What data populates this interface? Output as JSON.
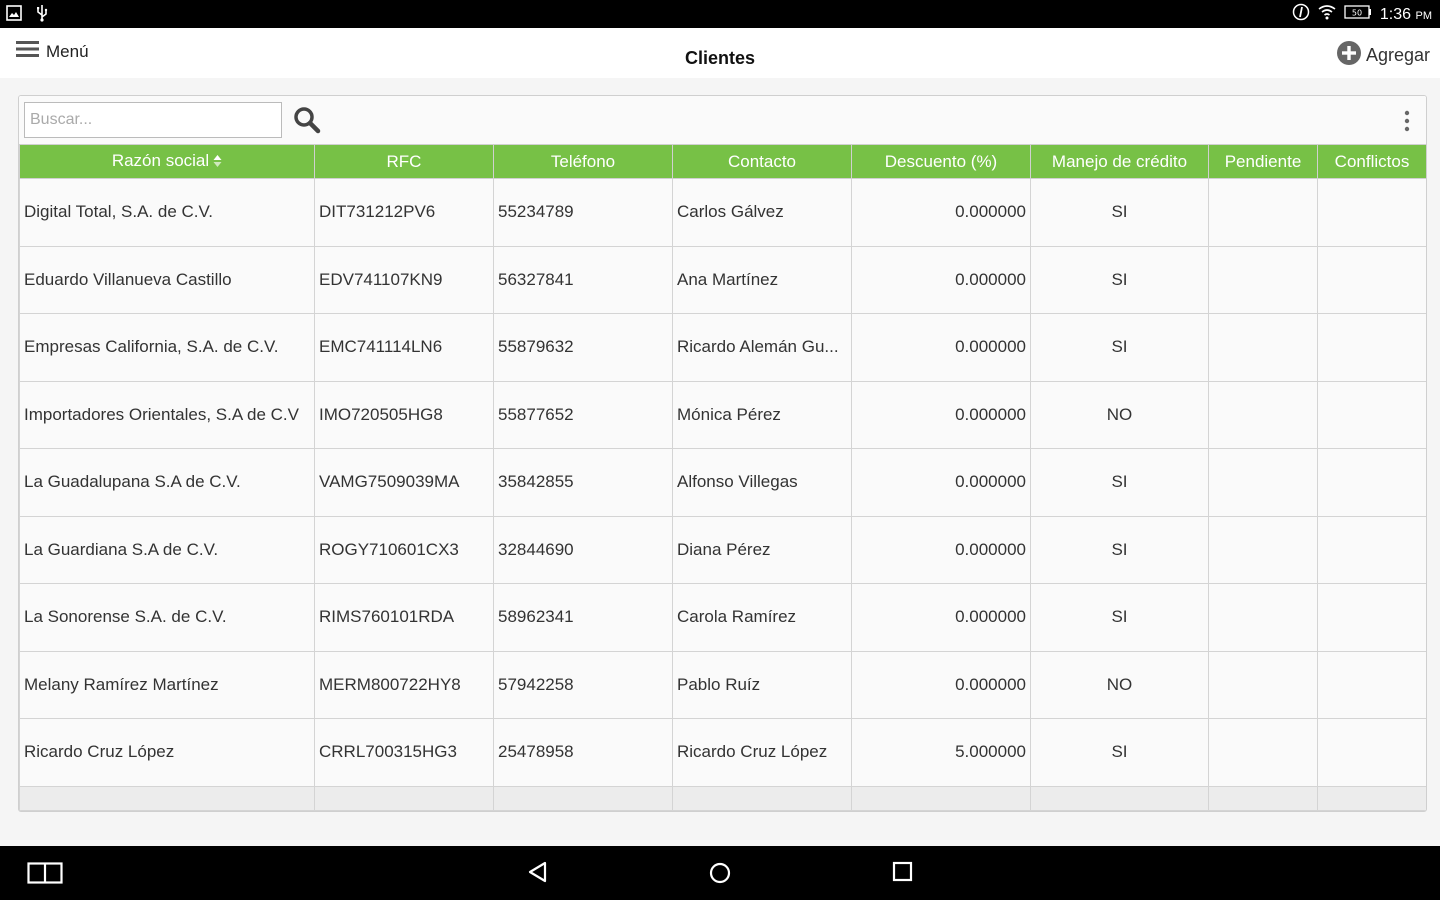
{
  "status": {
    "time": "1:36",
    "ampm": "PM",
    "battery": "50"
  },
  "header": {
    "menu_label": "Menú",
    "title": "Clientes",
    "add_label": "Agregar"
  },
  "search": {
    "placeholder": "Buscar...",
    "value": ""
  },
  "table": {
    "columns": [
      "Razón social",
      "RFC",
      "Teléfono",
      "Contacto",
      "Descuento (%)",
      "Manejo de crédito",
      "Pendiente",
      "Conflictos"
    ],
    "rows": [
      {
        "razon": "Digital Total, S.A. de C.V.",
        "rfc": "DIT731212PV6",
        "telefono": "55234789",
        "contacto": "Carlos Gálvez",
        "descuento": "0.000000",
        "credito": "SI",
        "pendiente": "",
        "conflictos": ""
      },
      {
        "razon": "Eduardo Villanueva Castillo",
        "rfc": "EDV741107KN9",
        "telefono": "56327841",
        "contacto": "Ana Martínez",
        "descuento": "0.000000",
        "credito": "SI",
        "pendiente": "",
        "conflictos": ""
      },
      {
        "razon": "Empresas California, S.A. de C.V.",
        "rfc": "EMC741114LN6",
        "telefono": "55879632",
        "contacto": "Ricardo Alemán Gu...",
        "descuento": "0.000000",
        "credito": "SI",
        "pendiente": "",
        "conflictos": ""
      },
      {
        "razon": "Importadores Orientales, S.A de C.V",
        "rfc": "IMO720505HG8",
        "telefono": "55877652",
        "contacto": "Mónica Pérez",
        "descuento": "0.000000",
        "credito": "NO",
        "pendiente": "",
        "conflictos": ""
      },
      {
        "razon": "La Guadalupana S.A de C.V.",
        "rfc": "VAMG7509039MA",
        "telefono": "35842855",
        "contacto": "Alfonso Villegas",
        "descuento": "0.000000",
        "credito": "SI",
        "pendiente": "",
        "conflictos": ""
      },
      {
        "razon": "La Guardiana S.A de C.V.",
        "rfc": "ROGY710601CX3",
        "telefono": "32844690",
        "contacto": "Diana Pérez",
        "descuento": "0.000000",
        "credito": "SI",
        "pendiente": "",
        "conflictos": ""
      },
      {
        "razon": "La Sonorense S.A. de C.V.",
        "rfc": "RIMS760101RDA",
        "telefono": "58962341",
        "contacto": "Carola Ramírez",
        "descuento": "0.000000",
        "credito": "SI",
        "pendiente": "",
        "conflictos": ""
      },
      {
        "razon": "Melany Ramírez Martínez",
        "rfc": "MERM800722HY8",
        "telefono": "57942258",
        "contacto": "Pablo Ruíz",
        "descuento": "0.000000",
        "credito": "NO",
        "pendiente": "",
        "conflictos": ""
      },
      {
        "razon": "Ricardo Cruz López",
        "rfc": "CRRL700315HG3",
        "telefono": "25478958",
        "contacto": "Ricardo Cruz López",
        "descuento": "5.000000",
        "credito": "SI",
        "pendiente": "",
        "conflictos": ""
      }
    ]
  },
  "colors": {
    "header_green": "#77c146",
    "status_bar": "#000000"
  },
  "icons": [
    "image-icon",
    "usb-icon",
    "info-icon",
    "wifi-icon",
    "battery-icon",
    "hamburger-icon",
    "add-circle-icon",
    "search-icon",
    "more-vert-icon",
    "sort-icon",
    "multiwindow-icon",
    "back-icon",
    "home-icon",
    "recents-icon"
  ]
}
